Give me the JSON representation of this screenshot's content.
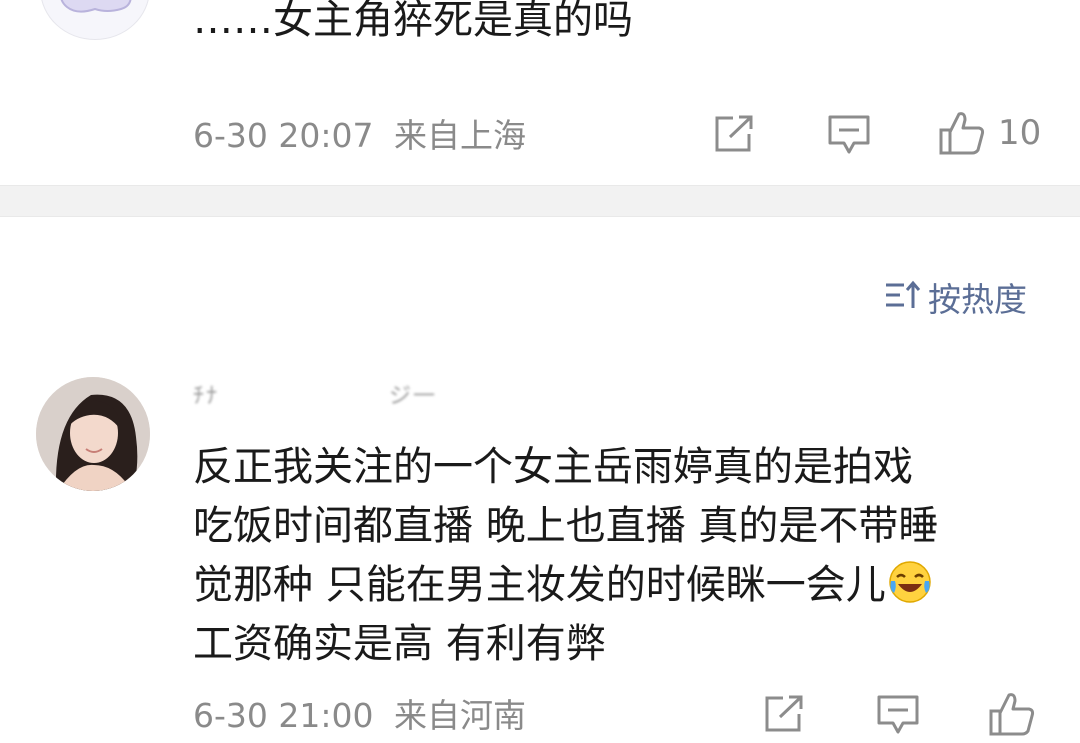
{
  "previous_comment": {
    "text": "……女主角猝死是真的吗",
    "timestamp": "6-30 20:07",
    "location": "来自上海",
    "like_count": "10"
  },
  "sort": {
    "label": "按热度"
  },
  "comment": {
    "username_left": "ﾁﾅ",
    "username_right": "ジ一",
    "lines": [
      "反正我关注的一个女主岳雨婷真的是拍戏",
      "吃饭时间都直播 晚上也直播 真的是不带睡",
      "觉那种 只能在男主妆发的时候眯一会儿",
      "工资确实是高 有利有弊"
    ],
    "timestamp": "6-30 21:00",
    "location": "来自河南"
  },
  "icons": {
    "share": "share-icon",
    "reply": "comment-icon",
    "like": "thumbs-up-icon",
    "sort": "sort-icon",
    "emoji": "laughing-crying-emoji"
  },
  "colors": {
    "meta_text": "#8a8a8a",
    "sort_accent": "#5b6e96",
    "divider": "#f2f2f2"
  }
}
